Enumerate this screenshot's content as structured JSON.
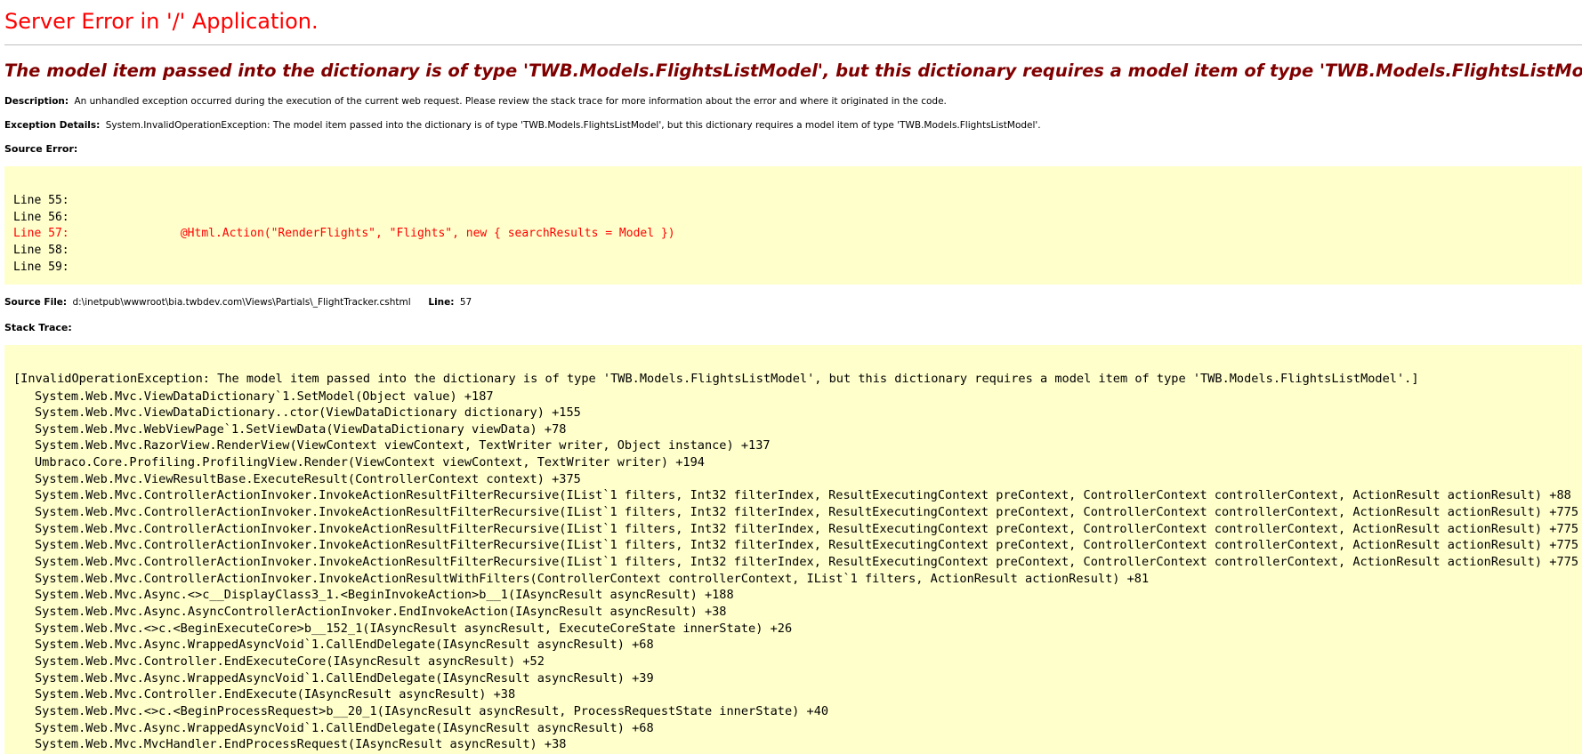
{
  "header": {
    "title": "Server Error in '/' Application.",
    "message": "The model item passed into the dictionary is of type 'TWB.Models.FlightsListModel', but this dictionary requires a model item of type 'TWB.Models.FlightsListModel'."
  },
  "description": {
    "label": "Description:",
    "text": "An unhandled exception occurred during the execution of the current web request. Please review the stack trace for more information about the error and where it originated in the code."
  },
  "exception": {
    "label": "Exception Details:",
    "text": "System.InvalidOperationException: The model item passed into the dictionary is of type 'TWB.Models.FlightsListModel', but this dictionary requires a model item of type 'TWB.Models.FlightsListModel'."
  },
  "source_error": {
    "label": "Source Error:",
    "lines": [
      {
        "label": "Line 55:",
        "code": "",
        "highlight": false
      },
      {
        "label": "Line 56:",
        "code": "",
        "highlight": false
      },
      {
        "label": "Line 57:",
        "code": "                @Html.Action(\"RenderFlights\", \"Flights\", new { searchResults = Model })",
        "highlight": true
      },
      {
        "label": "Line 58:",
        "code": "",
        "highlight": false
      },
      {
        "label": "Line 59:",
        "code": "",
        "highlight": false
      }
    ]
  },
  "source_file": {
    "label": "Source File:",
    "path": "d:\\inetpub\\wwwroot\\bia.twbdev.com\\Views\\Partials\\_FlightTracker.cshtml",
    "line_label": "Line:",
    "line_number": "57"
  },
  "stack_trace": {
    "label": "Stack Trace:",
    "head": "[InvalidOperationException: The model item passed into the dictionary is of type 'TWB.Models.FlightsListModel', but this dictionary requires a model item of type 'TWB.Models.FlightsListModel'.]",
    "frames": [
      "System.Web.Mvc.ViewDataDictionary`1.SetModel(Object value) +187",
      "System.Web.Mvc.ViewDataDictionary..ctor(ViewDataDictionary dictionary) +155",
      "System.Web.Mvc.WebViewPage`1.SetViewData(ViewDataDictionary viewData) +78",
      "System.Web.Mvc.RazorView.RenderView(ViewContext viewContext, TextWriter writer, Object instance) +137",
      "Umbraco.Core.Profiling.ProfilingView.Render(ViewContext viewContext, TextWriter writer) +194",
      "System.Web.Mvc.ViewResultBase.ExecuteResult(ControllerContext context) +375",
      "System.Web.Mvc.ControllerActionInvoker.InvokeActionResultFilterRecursive(IList`1 filters, Int32 filterIndex, ResultExecutingContext preContext, ControllerContext controllerContext, ActionResult actionResult) +88",
      "System.Web.Mvc.ControllerActionInvoker.InvokeActionResultFilterRecursive(IList`1 filters, Int32 filterIndex, ResultExecutingContext preContext, ControllerContext controllerContext, ActionResult actionResult) +775",
      "System.Web.Mvc.ControllerActionInvoker.InvokeActionResultFilterRecursive(IList`1 filters, Int32 filterIndex, ResultExecutingContext preContext, ControllerContext controllerContext, ActionResult actionResult) +775",
      "System.Web.Mvc.ControllerActionInvoker.InvokeActionResultFilterRecursive(IList`1 filters, Int32 filterIndex, ResultExecutingContext preContext, ControllerContext controllerContext, ActionResult actionResult) +775",
      "System.Web.Mvc.ControllerActionInvoker.InvokeActionResultFilterRecursive(IList`1 filters, Int32 filterIndex, ResultExecutingContext preContext, ControllerContext controllerContext, ActionResult actionResult) +775",
      "System.Web.Mvc.ControllerActionInvoker.InvokeActionResultWithFilters(ControllerContext controllerContext, IList`1 filters, ActionResult actionResult) +81",
      "System.Web.Mvc.Async.<>c__DisplayClass3_1.<BeginInvokeAction>b__1(IAsyncResult asyncResult) +188",
      "System.Web.Mvc.Async.AsyncControllerActionInvoker.EndInvokeAction(IAsyncResult asyncResult) +38",
      "System.Web.Mvc.<>c.<BeginExecuteCore>b__152_1(IAsyncResult asyncResult, ExecuteCoreState innerState) +26",
      "System.Web.Mvc.Async.WrappedAsyncVoid`1.CallEndDelegate(IAsyncResult asyncResult) +68",
      "System.Web.Mvc.Controller.EndExecuteCore(IAsyncResult asyncResult) +52",
      "System.Web.Mvc.Async.WrappedAsyncVoid`1.CallEndDelegate(IAsyncResult asyncResult) +39",
      "System.Web.Mvc.Controller.EndExecute(IAsyncResult asyncResult) +38",
      "System.Web.Mvc.<>c.<BeginProcessRequest>b__20_1(IAsyncResult asyncResult, ProcessRequestState innerState) +40",
      "System.Web.Mvc.Async.WrappedAsyncVoid`1.CallEndDelegate(IAsyncResult asyncResult) +68",
      "System.Web.Mvc.MvcHandler.EndProcessRequest(IAsyncResult asyncResult) +38"
    ]
  },
  "colors": {
    "title": "#ff0000",
    "message": "#800000",
    "code_background": "#ffffcc",
    "highlight_line": "#ff0000"
  }
}
